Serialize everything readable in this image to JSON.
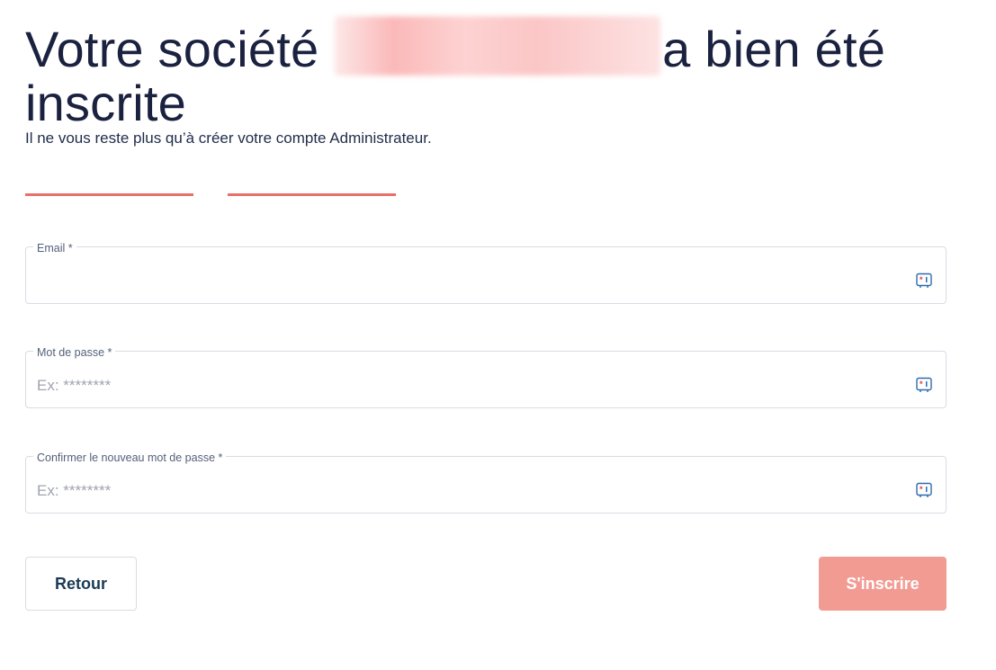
{
  "header": {
    "title_prefix": "Votre société",
    "title_suffix": "a bien été inscrite",
    "subtitle": "Il ne vous reste plus qu’à créer votre compte Administrateur."
  },
  "form": {
    "email": {
      "label": "Email *",
      "value": "",
      "placeholder": ""
    },
    "password": {
      "label": "Mot de passe *",
      "value": "",
      "placeholder": "Ex: ********"
    },
    "confirm_password": {
      "label": "Confirmer le nouveau mot de passe *",
      "value": "",
      "placeholder": "Ex: ********"
    },
    "field_icon": "password-manager-key-icon"
  },
  "actions": {
    "back_label": "Retour",
    "submit_label": "S'inscrire"
  },
  "colors": {
    "accent": "#e8706b",
    "submit_bg": "#f29b93",
    "title": "#1b2240"
  }
}
